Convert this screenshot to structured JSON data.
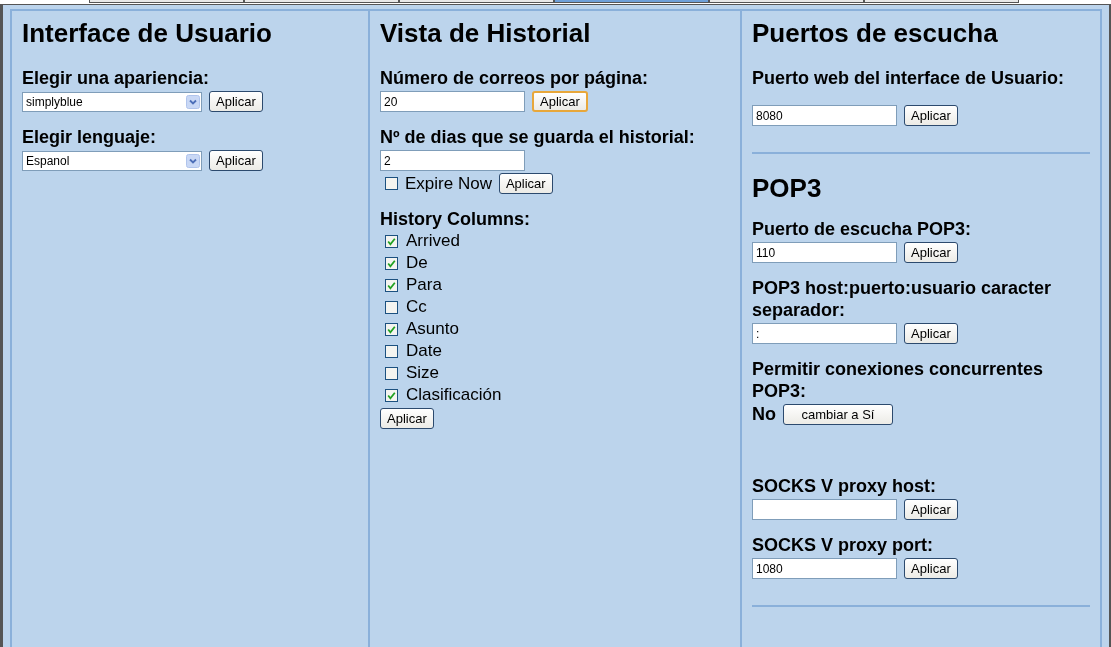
{
  "tabs": [
    {
      "selected": false
    },
    {
      "selected": false
    },
    {
      "selected": false
    },
    {
      "selected": true
    },
    {
      "selected": false
    },
    {
      "selected": false
    }
  ],
  "panels": [
    {
      "title": "Interface de Usuario",
      "items": [
        {
          "kind": "select",
          "label": "Elegir una apariencia:",
          "value": "simplyblue",
          "button": {
            "label": "Aplicar",
            "focused": false
          }
        },
        {
          "kind": "select",
          "label": "Elegir lenguaje:",
          "value": "Espanol",
          "button": {
            "label": "Aplicar",
            "focused": false
          }
        }
      ]
    },
    {
      "title": "Vista de Historial",
      "items": [
        {
          "kind": "input",
          "label": "Número de correos por página:",
          "value": "20",
          "button": {
            "label": "Aplicar",
            "focused": true
          }
        },
        {
          "kind": "input_check",
          "label": "Nº de dias que se guarda el historial:",
          "value": "2",
          "check": {
            "label": "Expire Now",
            "checked": false
          },
          "button": {
            "label": "Aplicar",
            "focused": false
          }
        },
        {
          "kind": "checklist",
          "label": "History Columns:",
          "options": [
            {
              "label": "Arrived",
              "checked": true
            },
            {
              "label": "De",
              "checked": true
            },
            {
              "label": "Para",
              "checked": true
            },
            {
              "label": "Cc",
              "checked": false
            },
            {
              "label": "Asunto",
              "checked": true
            },
            {
              "label": "Date",
              "checked": false
            },
            {
              "label": "Size",
              "checked": false
            },
            {
              "label": "Clasificación",
              "checked": true
            }
          ],
          "button": {
            "label": "Aplicar",
            "focused": false
          }
        }
      ]
    },
    {
      "title": "Puertos de escucha",
      "items": [
        {
          "kind": "input",
          "label": "Puerto web del interface de Usuario:",
          "value": "8080",
          "button": {
            "label": "Aplicar",
            "focused": false
          }
        },
        {
          "kind": "divider"
        },
        {
          "kind": "heading",
          "text": "POP3"
        },
        {
          "kind": "input",
          "label": "Puerto de escucha POP3:",
          "value": "110",
          "button": {
            "label": "Aplicar",
            "focused": false
          }
        },
        {
          "kind": "input",
          "label": "POP3 host:puerto:usuario caracter separador:",
          "value": ":",
          "button": {
            "label": "Aplicar",
            "focused": false
          }
        },
        {
          "kind": "toggle",
          "label": "Permitir conexiones concurrentes POP3:",
          "value": "No",
          "button": {
            "label": "cambiar a Sí",
            "focused": false
          }
        },
        {
          "kind": "input",
          "label": "SOCKS V proxy host:",
          "value": "",
          "button": {
            "label": "Aplicar",
            "focused": false
          }
        },
        {
          "kind": "input",
          "label": "SOCKS V proxy port:",
          "value": "1080",
          "button": {
            "label": "Aplicar",
            "focused": false
          }
        },
        {
          "kind": "divider"
        }
      ]
    }
  ]
}
